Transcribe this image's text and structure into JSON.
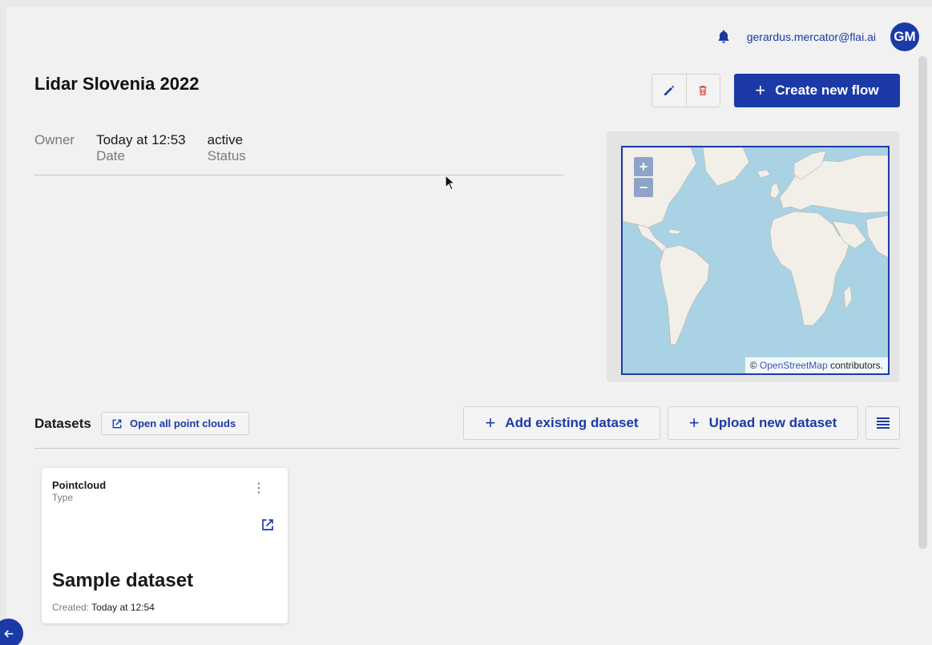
{
  "header": {
    "user_email": "gerardus.mercator@flai.ai",
    "avatar_initials": "GM"
  },
  "project": {
    "title": "Lidar Slovenia 2022",
    "create_flow_label": "Create new flow",
    "owner_label": "Owner",
    "date_value": "Today at 12:53",
    "date_label": "Date",
    "status_value": "active",
    "status_label": "Status"
  },
  "map": {
    "zoom_in": "+",
    "zoom_out": "−",
    "attribution_prefix": "©",
    "attribution_link": "OpenStreetMap",
    "attribution_suffix": "contributors."
  },
  "datasets": {
    "title": "Datasets",
    "open_all_label": "Open all point clouds",
    "add_existing_label": "Add existing dataset",
    "upload_new_label": "Upload new dataset",
    "items": [
      {
        "type": "Pointcloud",
        "type_label": "Type",
        "name": "Sample dataset",
        "created_label": "Created:",
        "created_value": "Today at 12:54"
      }
    ]
  },
  "colors": {
    "primary": "#1b3aa8",
    "danger": "#d9534f",
    "water": "#a9d3e4",
    "land": "#f2efe9"
  },
  "icons": {
    "notifications": "bell-icon",
    "edit": "pencil-icon",
    "delete": "trash-icon",
    "open_external": "external-link-icon",
    "list_view": "list-icon",
    "card_menu": "more-vertical-icon",
    "back": "arrow-left-icon"
  }
}
